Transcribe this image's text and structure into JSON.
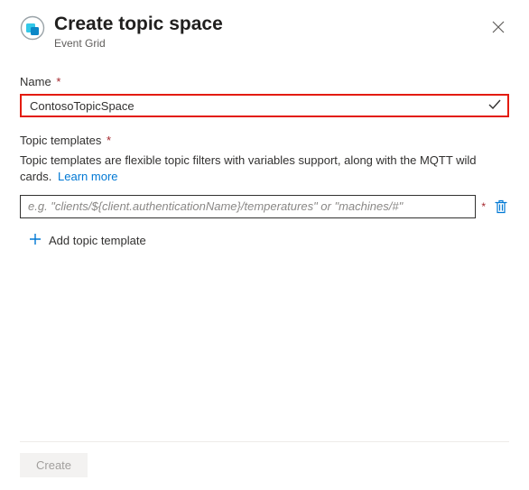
{
  "header": {
    "title": "Create topic space",
    "subtitle": "Event Grid"
  },
  "name_field": {
    "label": "Name",
    "value": "ContosoTopicSpace"
  },
  "templates_field": {
    "label": "Topic templates",
    "description": "Topic templates are flexible topic filters with variables support, along with the MQTT wild cards.",
    "learn_more": "Learn more",
    "input_placeholder": "e.g. \"clients/${client.authenticationName}/temperatures\" or \"machines/#\"",
    "add_text": "Add topic template"
  },
  "footer": {
    "create_label": "Create"
  },
  "required_marker": "*"
}
